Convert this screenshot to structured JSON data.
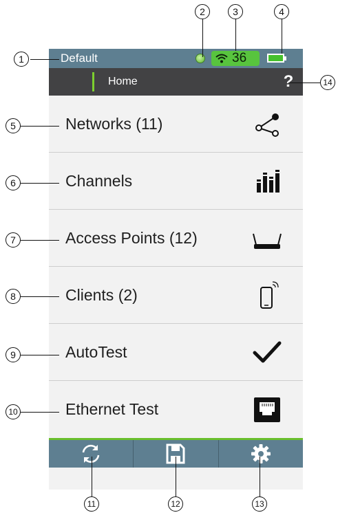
{
  "callouts": [
    "1",
    "2",
    "3",
    "4",
    "5",
    "6",
    "7",
    "8",
    "9",
    "10",
    "11",
    "12",
    "13",
    "14"
  ],
  "status": {
    "profile": "Default",
    "wifi_count": "36",
    "battery_level": 1.0,
    "colors": {
      "bar": "#5e7f91",
      "wifi_badge": "#58c43e",
      "battery": "#45c02c",
      "gps": "#5ab82c"
    },
    "icons": [
      "gps-indicator-icon",
      "wifi-icon",
      "battery-icon"
    ]
  },
  "nav": {
    "title": "Home",
    "help_label": "?",
    "colors": {
      "bar": "#424244",
      "accent": "#7ccf2f"
    }
  },
  "menu": [
    {
      "label": "Networks (11)",
      "icon": "share-network-icon"
    },
    {
      "label": "Channels",
      "icon": "channels-bars-icon"
    },
    {
      "label": "Access Points (12)",
      "icon": "router-icon"
    },
    {
      "label": "Clients (2)",
      "icon": "smartphone-icon"
    },
    {
      "label": "AutoTest",
      "icon": "checkmark-icon"
    },
    {
      "label": "Ethernet Test",
      "icon": "ethernet-port-icon"
    }
  ],
  "toolbar": {
    "icons": [
      "refresh-icon",
      "save-icon",
      "settings-gear-icon"
    ],
    "colors": {
      "bar": "#5e7f91",
      "divider": "#6abf2d"
    }
  }
}
